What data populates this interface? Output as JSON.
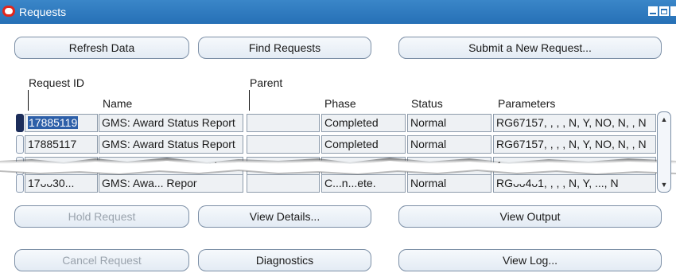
{
  "window": {
    "title": "Requests",
    "controls": [
      "minimize",
      "maximize",
      "close"
    ]
  },
  "toolbar": {
    "refresh_label": "Refresh Data",
    "find_label": "Find Requests",
    "submit_label": "Submit a New Request..."
  },
  "columns": {
    "request_id": "Request ID",
    "parent": "Parent",
    "name": "Name",
    "phase": "Phase",
    "status": "Status",
    "parameters": "Parameters"
  },
  "rows": [
    {
      "request_id": "17885119",
      "name": "GMS: Award Status Report",
      "parent": "",
      "phase": "Completed",
      "status": "Normal",
      "parameters": "RG67157, , , , N, Y, NO, N, , N"
    },
    {
      "request_id": "17885117",
      "name": "GMS: Award Status Report",
      "parent": "",
      "phase": "Completed",
      "status": "Normal",
      "parameters": "RG67157, , , , N, Y, NO, N, , N"
    },
    {
      "request_id": "17",
      "name": "atus R",
      "parent": "",
      "phase": "",
      "status": "",
      "parameters": "1"
    },
    {
      "request_id": "17ᴗᴗ30...",
      "name": "GMS: Awa...  Repor",
      "parent": "",
      "phase": "C...n...ete.",
      "status": "Normal",
      "parameters": "RGᴗᴗ4ᴗ1, , , , N, Y, ..., N"
    }
  ],
  "actions": {
    "hold_label": "Hold Request",
    "view_details_label": "View Details...",
    "view_output_label": "View Output",
    "cancel_label": "Cancel Request",
    "diagnostics_label": "Diagnostics",
    "view_log_label": "View Log..."
  },
  "icons": {
    "app_logo": "oracle-logo-icon",
    "scroll_up": "scroll-up-arrow-icon",
    "scroll_down": "scroll-down-arrow-icon"
  },
  "colors": {
    "titlebar": "#2670b6",
    "selection": "#2d5fa8",
    "current_record": "#1c2d5a",
    "disabled_text": "#9aa3ad"
  }
}
